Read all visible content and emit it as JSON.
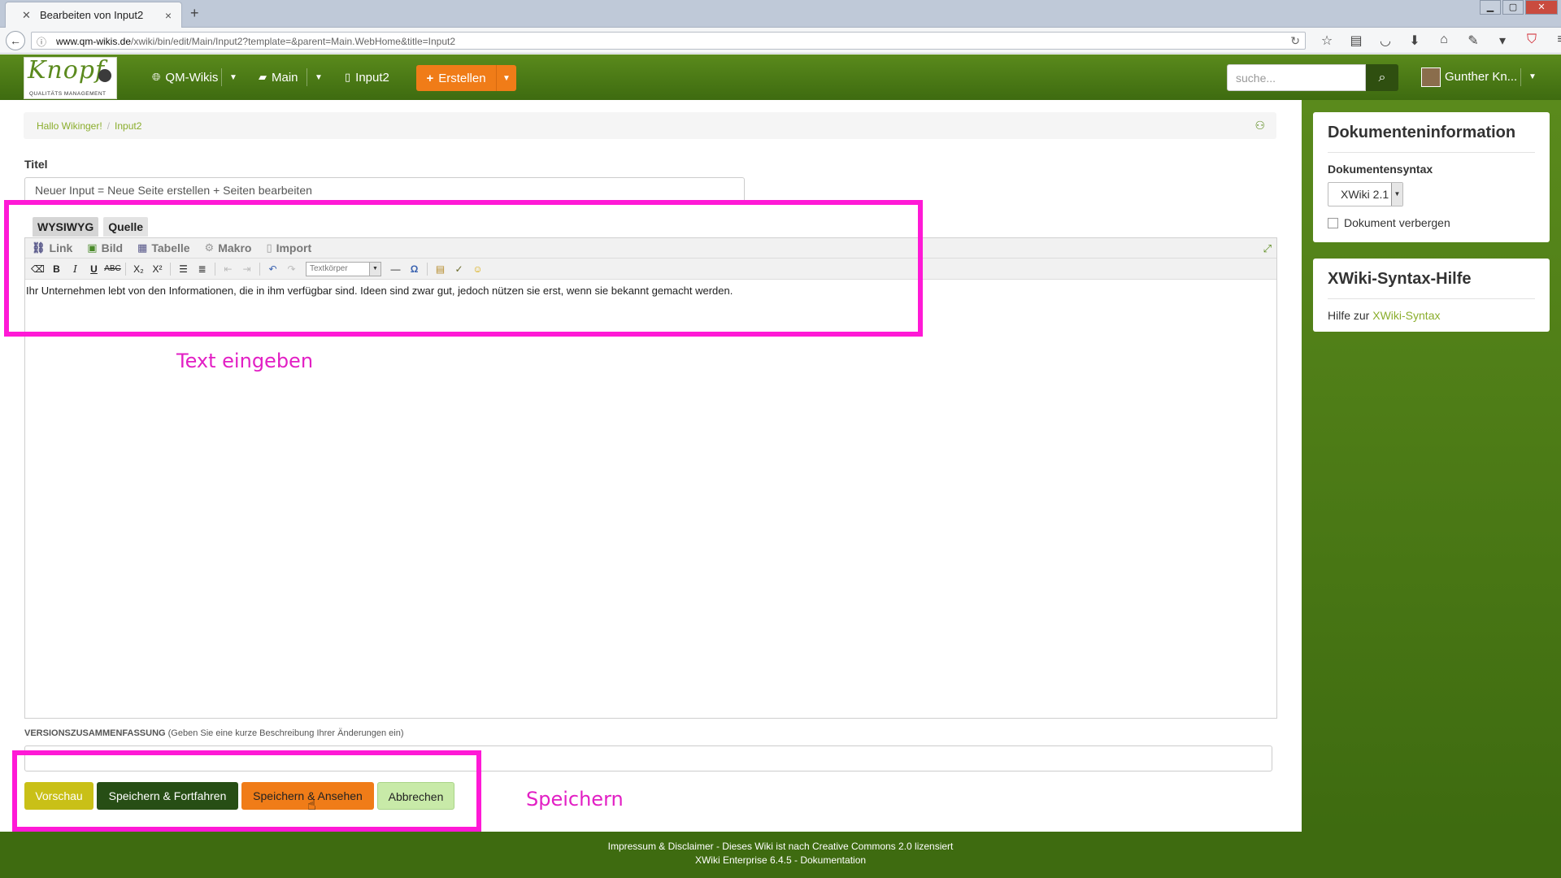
{
  "browser": {
    "tab_title": "Bearbeiten von Input2",
    "new_tab": "+",
    "url_host": "www.qm-wikis.de",
    "url_path": "/xwiki/bin/edit/Main/Input2?template=&parent=Main.WebHome&title=Input2",
    "window_controls": [
      "▁",
      "▢",
      "✕"
    ],
    "toolbar_icons": [
      "star-icon",
      "reading-list-icon",
      "pocket-icon",
      "download-icon",
      "home-icon",
      "tools-icon",
      "dropdown-icon",
      "shield-icon",
      "menu-icon"
    ]
  },
  "header": {
    "logo_word": "Knopf",
    "logo_sub": "QUALITÄTS MANAGEMENT",
    "nav": [
      {
        "label": "QM-Wikis",
        "icon": "globe-icon"
      },
      {
        "label": "Main",
        "icon": "folder-icon"
      },
      {
        "label": "Input2",
        "icon": "file-icon"
      }
    ],
    "create_label": "Erstellen",
    "search_placeholder": "suche...",
    "user_name": "Gunther Kn..."
  },
  "breadcrumb": {
    "items": [
      "Hallo Wikinger!",
      "Input2"
    ],
    "separator": "/"
  },
  "form": {
    "title_label": "Titel",
    "title_value": "Neuer Input = Neue Seite erstellen + Seiten bearbeiten",
    "editor_tabs": [
      "WYSIWYG",
      "Quelle"
    ],
    "menu": [
      "Link",
      "Bild",
      "Tabelle",
      "Makro",
      "Import"
    ],
    "format_select": "Textkörper",
    "content": "Ihr Unternehmen lebt von den Informationen, die in ihm verfügbar sind. Ideen sind zwar gut, jedoch nützen sie erst, wenn sie bekannt gemacht werden.",
    "version_label": "VERSIONSZUSAMMENFASSUNG",
    "version_hint": "(Geben Sie eine kurze Beschreibung Ihrer Änderungen ein)",
    "buttons": {
      "preview": "Vorschau",
      "save_continue": "Speichern & Fortfahren",
      "save_view": "Speichern & Ansehen",
      "cancel": "Abbrechen"
    }
  },
  "sidebar": {
    "doc_info_title": "Dokumenteninformation",
    "syntax_label": "Dokumentensyntax",
    "syntax_value": "XWiki 2.1",
    "hide_doc_label": "Dokument verbergen",
    "help_title": "XWiki-Syntax-Hilfe",
    "help_prefix": "Hilfe zur",
    "help_link": "XWiki-Syntax"
  },
  "footer": {
    "line1": "Impressum & Disclaimer - Dieses Wiki ist nach Creative Commons 2.0 lizensiert",
    "line2": "XWiki Enterprise 6.4.5 - Dokumentation"
  },
  "annotations": {
    "text_hint": "Text eingeben",
    "save_hint": "Speichern"
  },
  "colors": {
    "brand_green": "#5a8a1c",
    "accent_orange": "#f07c18",
    "annotation_magenta": "#ff19d6",
    "link_green": "#8aad2c"
  }
}
